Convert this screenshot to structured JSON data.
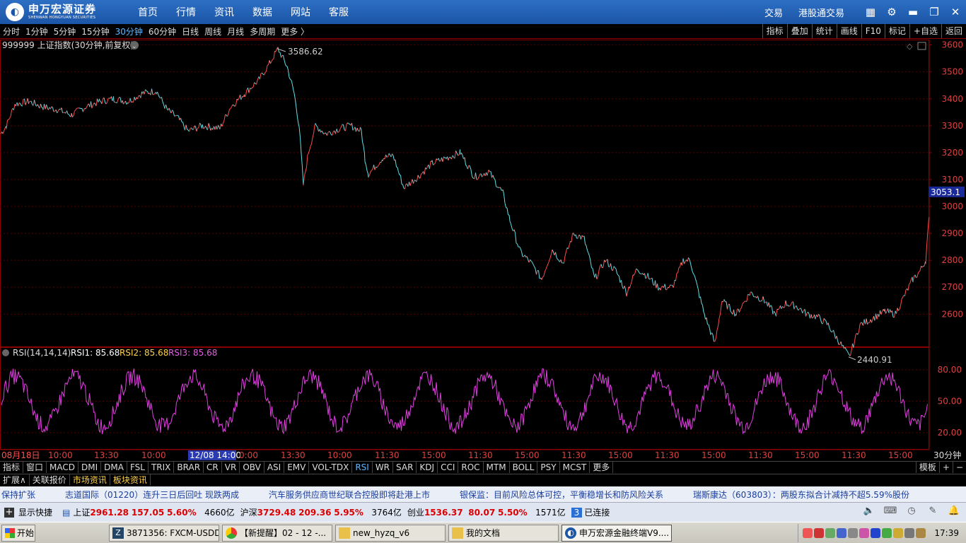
{
  "titlebar": {
    "logo_cn": "申万宏源证券",
    "logo_en": "SHENWAN HONGYUAN SECURITIES",
    "nav": [
      "首页",
      "行情",
      "资讯",
      "数据",
      "网站",
      "客服"
    ],
    "right_links": [
      "交易",
      "港股通交易"
    ]
  },
  "periods": [
    "分时",
    "1分钟",
    "5分钟",
    "15分钟",
    "30分钟",
    "60分钟",
    "日线",
    "周线",
    "月线",
    "多周期",
    "更多 〉"
  ],
  "active_period": "30分钟",
  "right_tools": [
    "指标",
    "叠加",
    "统计",
    "画线",
    "F10",
    "标记",
    "+自选",
    "返回"
  ],
  "chart_data": {
    "type": "line",
    "symbol_label": "999999 上证指数(30分钟,前复权)",
    "price_axis_ticks": [
      3600,
      3500,
      3400,
      3300,
      3200,
      3100,
      3000,
      2900,
      2800,
      2700,
      2600
    ],
    "ylim": [
      2480,
      3620
    ],
    "current_price_label": "3053.1",
    "high_label": "3586.62",
    "low_label": "2440.91",
    "price_keypoints": [
      [
        0,
        3270
      ],
      [
        8,
        3300
      ],
      [
        20,
        3380
      ],
      [
        40,
        3390
      ],
      [
        60,
        3370
      ],
      [
        80,
        3360
      ],
      [
        100,
        3340
      ],
      [
        120,
        3370
      ],
      [
        140,
        3390
      ],
      [
        160,
        3400
      ],
      [
        180,
        3390
      ],
      [
        200,
        3420
      ],
      [
        220,
        3430
      ],
      [
        235,
        3360
      ],
      [
        250,
        3330
      ],
      [
        265,
        3280
      ],
      [
        285,
        3300
      ],
      [
        310,
        3290
      ],
      [
        325,
        3370
      ],
      [
        345,
        3420
      ],
      [
        365,
        3470
      ],
      [
        380,
        3530
      ],
      [
        392,
        3586
      ],
      [
        405,
        3520
      ],
      [
        415,
        3420
      ],
      [
        422,
        3300
      ],
      [
        428,
        3080
      ],
      [
        435,
        3200
      ],
      [
        445,
        3300
      ],
      [
        460,
        3270
      ],
      [
        480,
        3290
      ],
      [
        495,
        3300
      ],
      [
        510,
        3280
      ],
      [
        515,
        3180
      ],
      [
        520,
        3120
      ],
      [
        540,
        3180
      ],
      [
        555,
        3190
      ],
      [
        570,
        3070
      ],
      [
        590,
        3110
      ],
      [
        610,
        3160
      ],
      [
        630,
        3180
      ],
      [
        650,
        3200
      ],
      [
        670,
        3110
      ],
      [
        690,
        3130
      ],
      [
        710,
        3050
      ],
      [
        720,
        2950
      ],
      [
        735,
        2830
      ],
      [
        750,
        2790
      ],
      [
        765,
        2730
      ],
      [
        780,
        2840
      ],
      [
        795,
        2790
      ],
      [
        810,
        2900
      ],
      [
        825,
        2880
      ],
      [
        840,
        2730
      ],
      [
        855,
        2800
      ],
      [
        870,
        2760
      ],
      [
        885,
        2680
      ],
      [
        900,
        2770
      ],
      [
        915,
        2740
      ],
      [
        930,
        2700
      ],
      [
        950,
        2700
      ],
      [
        965,
        2800
      ],
      [
        975,
        2800
      ],
      [
        985,
        2700
      ],
      [
        995,
        2600
      ],
      [
        1010,
        2490
      ],
      [
        1020,
        2650
      ],
      [
        1040,
        2600
      ],
      [
        1060,
        2680
      ],
      [
        1080,
        2650
      ],
      [
        1095,
        2600
      ],
      [
        1110,
        2640
      ],
      [
        1125,
        2630
      ],
      [
        1140,
        2600
      ],
      [
        1155,
        2590
      ],
      [
        1170,
        2560
      ],
      [
        1185,
        2500
      ],
      [
        1200,
        2441
      ],
      [
        1215,
        2560
      ],
      [
        1230,
        2580
      ],
      [
        1250,
        2610
      ],
      [
        1265,
        2600
      ],
      [
        1280,
        2680
      ],
      [
        1290,
        2730
      ],
      [
        1300,
        2760
      ],
      [
        1308,
        2800
      ],
      [
        1311,
        2900
      ],
      [
        1313,
        2960
      ]
    ],
    "rsi_label": "RSI(14,14,14)",
    "rsi1_label": "RSI1: 85.68",
    "rsi2_label": "RSI2: 85.68",
    "rsi3_label": "RSI3: 85.68",
    "rsi_axis_ticks": [
      80,
      50,
      20
    ],
    "rsi_axis_labels": [
      "80.00",
      "50.00",
      "20.00"
    ],
    "time_labels": [
      "08月18日",
      "10:00",
      "13:30",
      "10:00",
      "12/08 14:00",
      "0:00",
      "13:30",
      "10:00",
      "11:30",
      "15:00",
      "11:30",
      "15:00",
      "11:30",
      "15:00",
      "11:30",
      "15:00",
      "11:30",
      "15:00",
      "11:30",
      "15:00"
    ],
    "period_corner_label": "30分钟"
  },
  "indicator_tabs": [
    "指标",
    "窗口",
    "MACD",
    "DMI",
    "DMA",
    "FSL",
    "TRIX",
    "BRAR",
    "CR",
    "VR",
    "OBV",
    "ASI",
    "EMV",
    "VOL-TDX",
    "RSI",
    "WR",
    "SAR",
    "KDJ",
    "CCI",
    "ROC",
    "MTM",
    "BOLL",
    "PSY",
    "MCST",
    "更多"
  ],
  "active_indicator": "RSI",
  "indicator_right": [
    "模板",
    "+",
    "−"
  ],
  "sub_tabs": [
    "扩展∧",
    "关联报价",
    "市场资讯",
    "板块资讯"
  ],
  "news": [
    "保持扩张",
    "志道国际（01220）连升三日后回吐 现跌两成",
    "汽车服务供应商世纪联合控股即将赴港上市",
    "银保监：目前风险总体可控，平衡稳增长和防风险关系",
    "瑞斯康达（603803）：两股东拟合计减持不超5.59%股份"
  ],
  "status": {
    "shortcut": "显示快捷",
    "sh_name": "上证",
    "sh_price": "2961.28",
    "sh_change": "157.05",
    "sh_pct": "5.60%",
    "sh_amount": "4660亿",
    "hs_name": "沪深",
    "hs_price": "3729.48",
    "hs_change": "209.36",
    "hs_pct": "5.95%",
    "hs_amount": "3764亿",
    "cy_name": "创业",
    "cy_price": "1536.37",
    "cy_change": "80.07",
    "cy_pct": "5.50%",
    "cy_amount": "1571亿",
    "conn_count": "3",
    "conn_text": "已连接"
  },
  "taskbar": {
    "start": "开始",
    "tasks": [
      "3871356: FXCM-USDDe...",
      "【新提醒】02 - 12 -...",
      "new_hyzq_v6",
      "我的文档",
      "申万宏源金融终端V9...."
    ],
    "clock": "17:39"
  }
}
